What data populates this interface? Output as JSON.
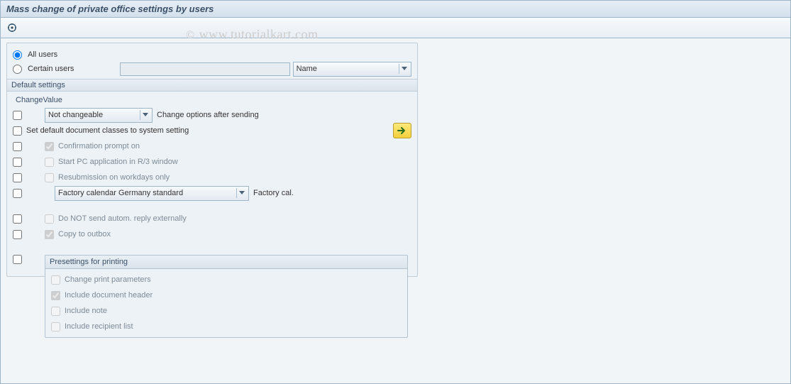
{
  "title": "Mass change of private office settings by users",
  "watermark": "www.tutorialkart.com",
  "watermark_copy": "©",
  "userSelect": {
    "allUsers": "All users",
    "certainUsers": "Certain users",
    "nameField": "",
    "nameDropdown": "Name"
  },
  "group": {
    "label": "Default settings",
    "changeValue": "ChangeValue",
    "changeOptionsDropdown": "Not changeable",
    "changeOptionsLabel": "Change options after sending",
    "setDefaultDocClasses": "Set default document classes to system setting",
    "confirmationPrompt": "Confirmation prompt on",
    "startPcApp": "Start PC application in R/3 window",
    "resubmission": "Resubmission on workdays only",
    "factoryCalDropdown": "Factory calendar Germany standard",
    "factoryCalLabel": "Factory cal.",
    "doNotSendAuto": "Do NOT send autom. reply externally",
    "copyToOutbox": "Copy to outbox"
  },
  "printGroup": {
    "header": "Presettings for printing",
    "changePrintParams": "Change print parameters",
    "includeDocHeader": "Include document header",
    "includeNote": "Include note",
    "includeRecipientList": "Include recipient list"
  }
}
